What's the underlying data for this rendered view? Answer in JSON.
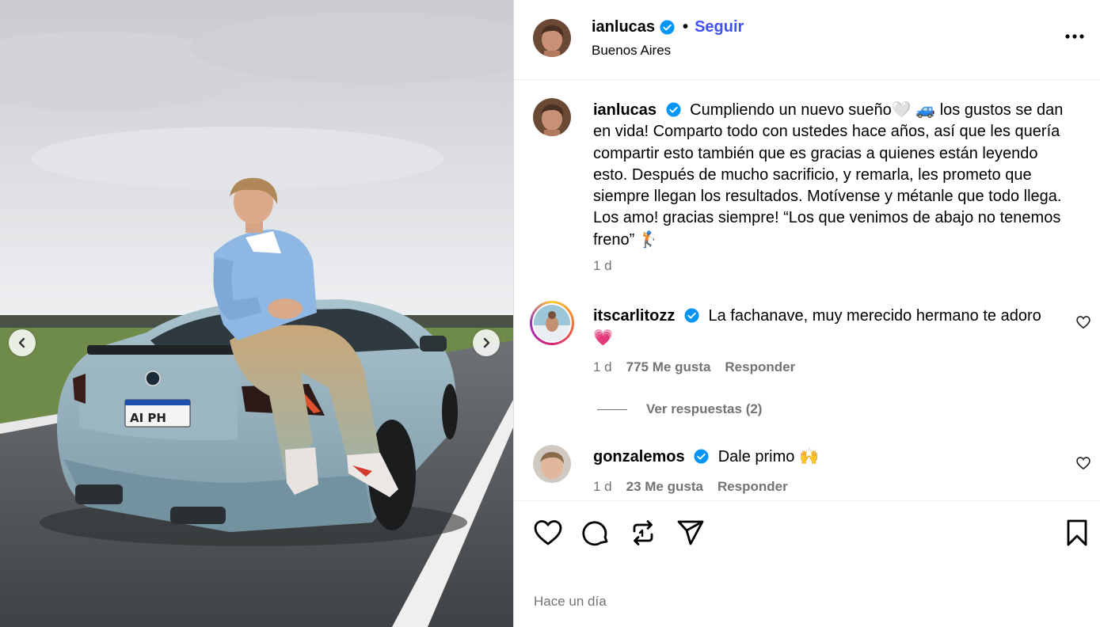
{
  "header": {
    "username": "ianlucas",
    "separator": "•",
    "follow_label": "Seguir",
    "location": "Buenos Aires"
  },
  "caption": {
    "username": "ianlucas",
    "text": "Cumpliendo un nuevo sueño🤍 🚙 los gustos se dan en vida! Comparto todo con ustedes hace años, así que les quería compartir esto también que es gracias a quienes están leyendo esto. Después de mucho sacrificio, y remarla, les prometo que siempre llegan los resultados. Motívense y métanle que todo llega. Los amo! gracias siempre! “Los que venimos de abajo no tenemos freno” 🏌",
    "time": "1 d"
  },
  "comments": [
    {
      "username": "itscarlitozz",
      "text": "La fachanave, muy merecido hermano te adoro 💗",
      "time": "1 d",
      "likes": "775 Me gusta",
      "reply_label": "Responder",
      "view_replies": "Ver respuestas (2)"
    },
    {
      "username": "gonzalemos",
      "text": "Dale primo 🙌",
      "time": "1 d",
      "likes": "23 Me gusta",
      "reply_label": "Responder"
    }
  ],
  "footer": {
    "time_ago": "Hace un día"
  },
  "media": {
    "plate_text": "AI PH"
  },
  "icons": {
    "verified": "verified-badge-icon",
    "more": "more-options-icon",
    "like": "heart-icon",
    "comment": "comment-bubble-icon",
    "repost": "repost-icon",
    "share": "send-icon",
    "save": "bookmark-icon",
    "prev": "chevron-left-icon",
    "next": "chevron-right-icon"
  },
  "colors": {
    "follow": "#4150f7",
    "verified": "#0095f6",
    "muted": "#737373"
  }
}
